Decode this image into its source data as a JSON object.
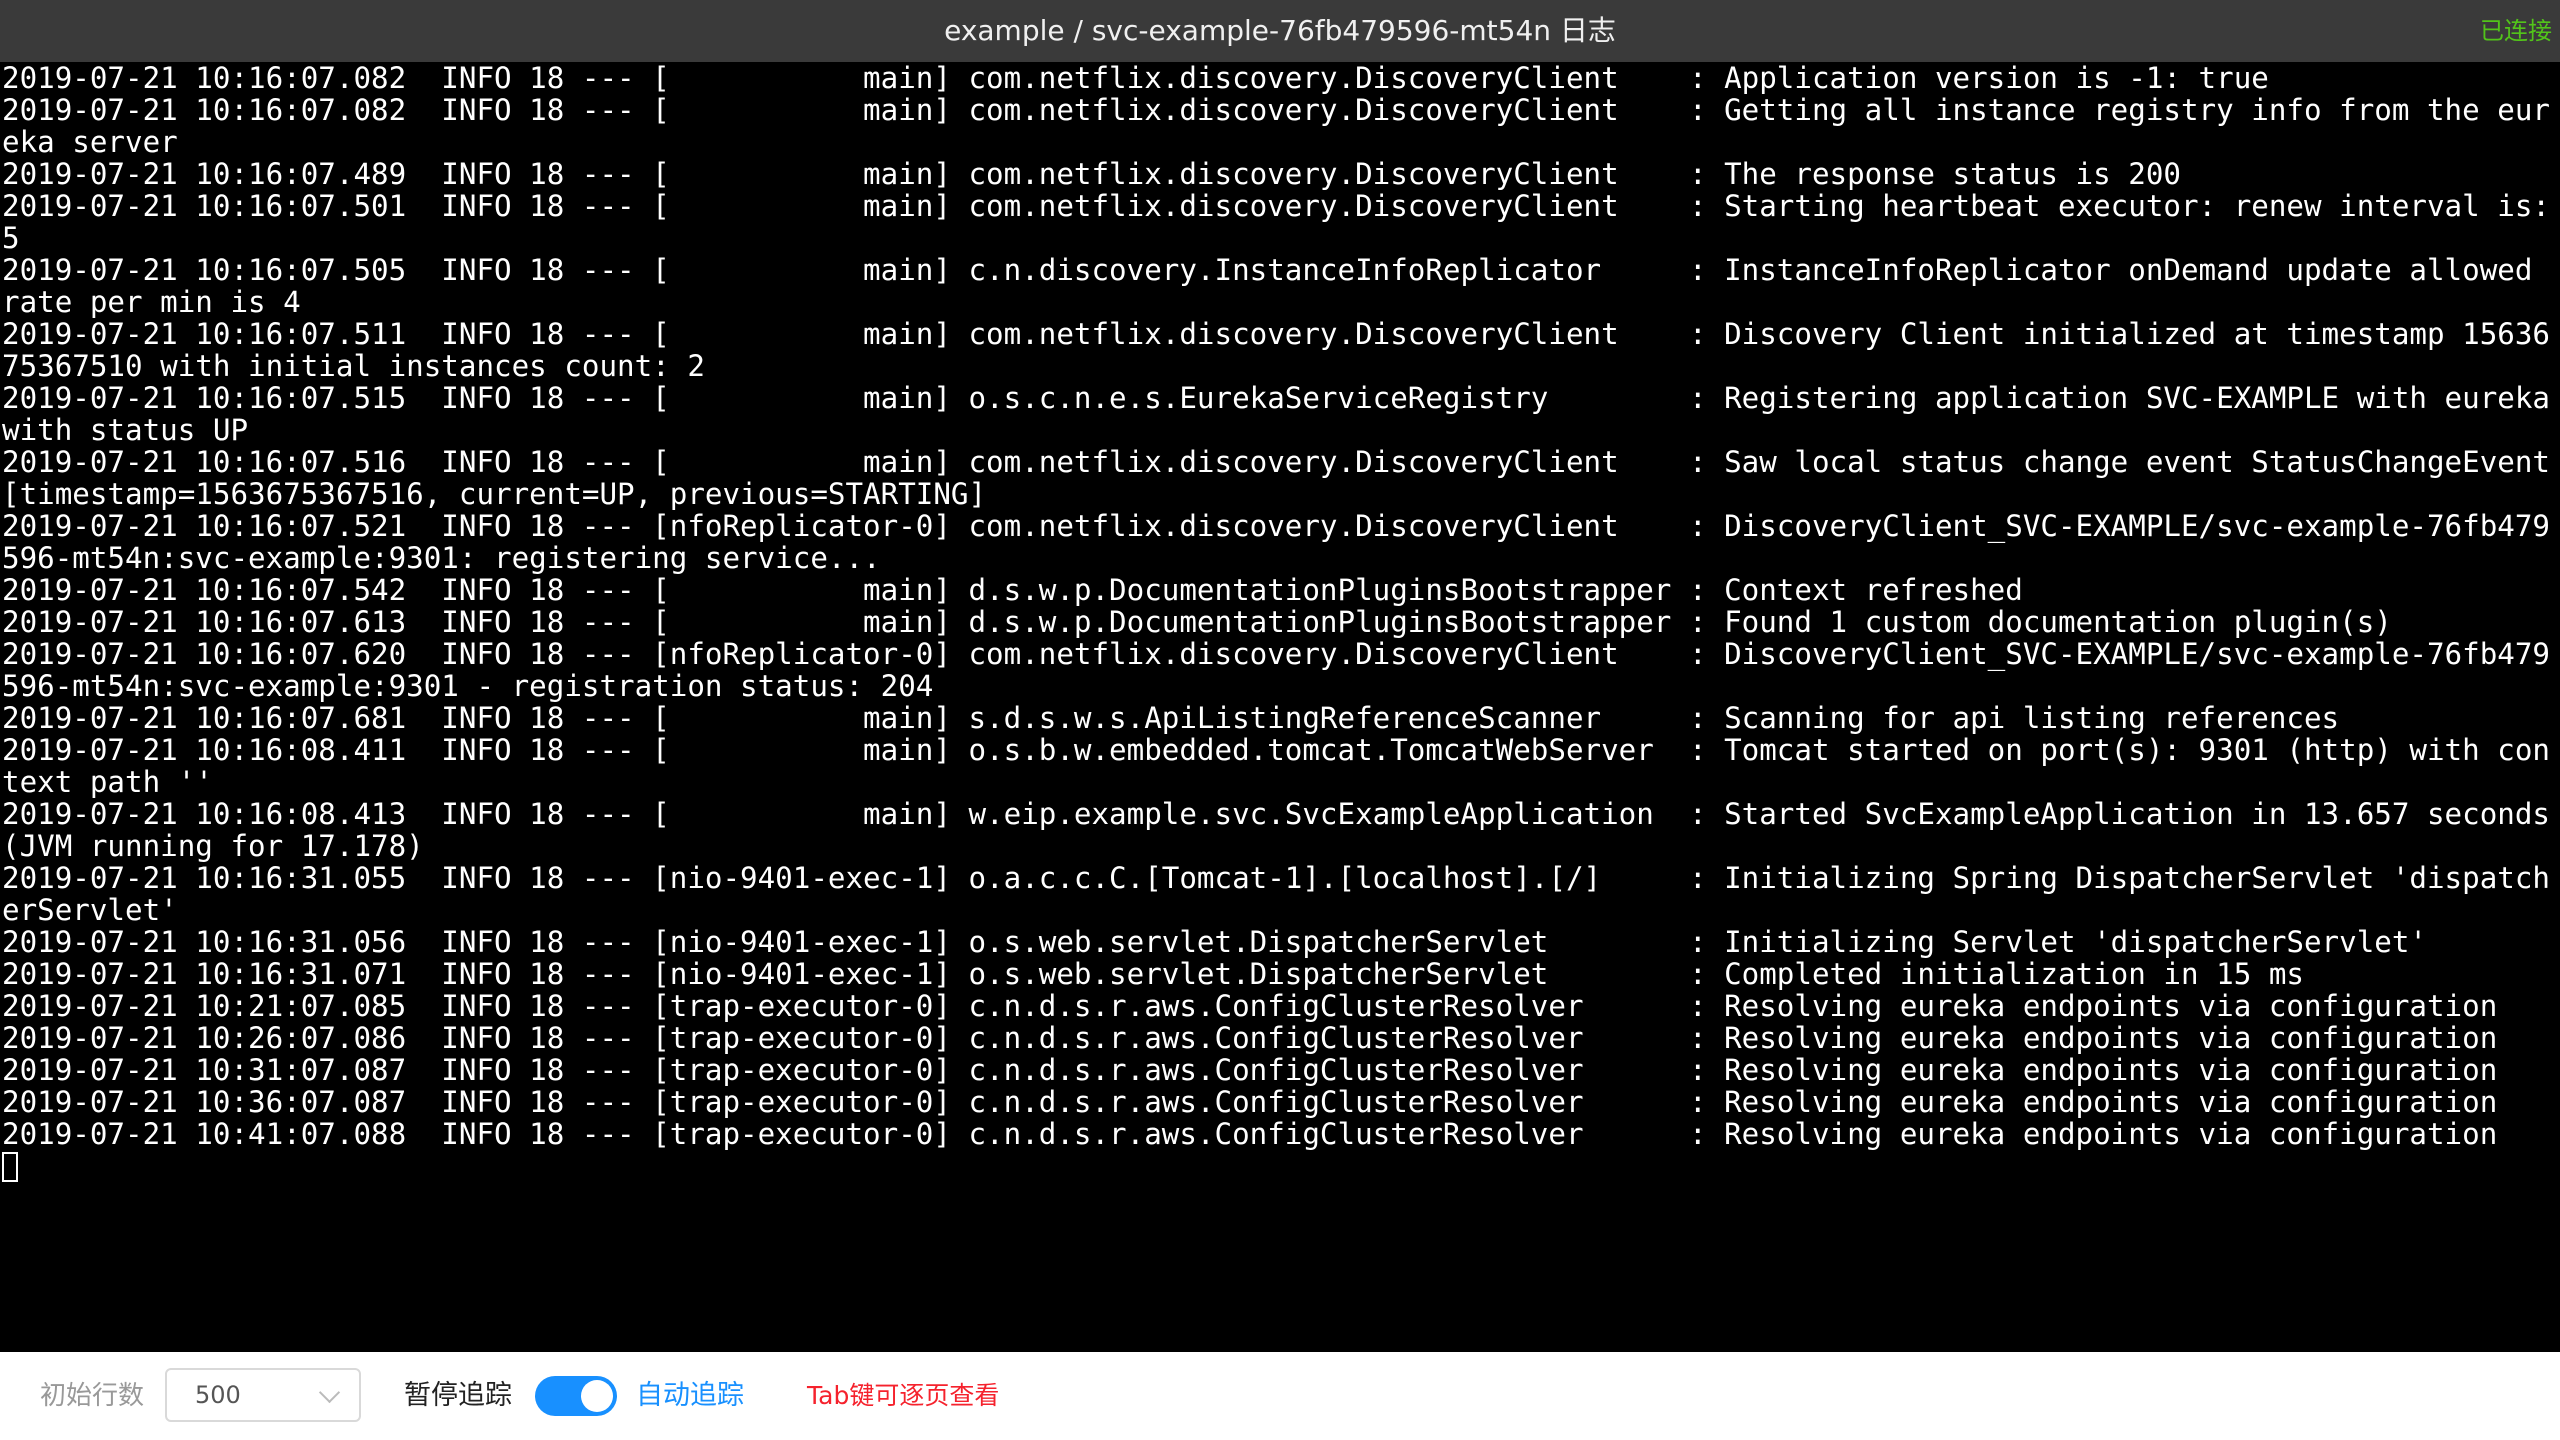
{
  "window": {
    "title": "example / svc-example-76fb479596-mt54n 日志",
    "connection_status": "已连接",
    "connection_color": "#52c41a"
  },
  "log": {
    "lines": [
      "2019-07-21 10:16:07.082  INFO 18 --- [           main] com.netflix.discovery.DiscoveryClient    : Application version is -1: true",
      "2019-07-21 10:16:07.082  INFO 18 --- [           main] com.netflix.discovery.DiscoveryClient    : Getting all instance registry info from the eureka server",
      "2019-07-21 10:16:07.489  INFO 18 --- [           main] com.netflix.discovery.DiscoveryClient    : The response status is 200",
      "2019-07-21 10:16:07.501  INFO 18 --- [           main] com.netflix.discovery.DiscoveryClient    : Starting heartbeat executor: renew interval is: 5",
      "2019-07-21 10:16:07.505  INFO 18 --- [           main] c.n.discovery.InstanceInfoReplicator     : InstanceInfoReplicator onDemand update allowed rate per min is 4",
      "2019-07-21 10:16:07.511  INFO 18 --- [           main] com.netflix.discovery.DiscoveryClient    : Discovery Client initialized at timestamp 1563675367510 with initial instances count: 2",
      "2019-07-21 10:16:07.515  INFO 18 --- [           main] o.s.c.n.e.s.EurekaServiceRegistry        : Registering application SVC-EXAMPLE with eureka with status UP",
      "2019-07-21 10:16:07.516  INFO 18 --- [           main] com.netflix.discovery.DiscoveryClient    : Saw local status change event StatusChangeEvent [timestamp=1563675367516, current=UP, previous=STARTING]",
      "2019-07-21 10:16:07.521  INFO 18 --- [nfoReplicator-0] com.netflix.discovery.DiscoveryClient    : DiscoveryClient_SVC-EXAMPLE/svc-example-76fb479596-mt54n:svc-example:9301: registering service...",
      "2019-07-21 10:16:07.542  INFO 18 --- [           main] d.s.w.p.DocumentationPluginsBootstrapper : Context refreshed",
      "2019-07-21 10:16:07.613  INFO 18 --- [           main] d.s.w.p.DocumentationPluginsBootstrapper : Found 1 custom documentation plugin(s)",
      "2019-07-21 10:16:07.620  INFO 18 --- [nfoReplicator-0] com.netflix.discovery.DiscoveryClient    : DiscoveryClient_SVC-EXAMPLE/svc-example-76fb479596-mt54n:svc-example:9301 - registration status: 204",
      "2019-07-21 10:16:07.681  INFO 18 --- [           main] s.d.s.w.s.ApiListingReferenceScanner     : Scanning for api listing references",
      "2019-07-21 10:16:08.411  INFO 18 --- [           main] o.s.b.w.embedded.tomcat.TomcatWebServer  : Tomcat started on port(s): 9301 (http) with context path ''",
      "2019-07-21 10:16:08.413  INFO 18 --- [           main] w.eip.example.svc.SvcExampleApplication  : Started SvcExampleApplication in 13.657 seconds (JVM running for 17.178)",
      "2019-07-21 10:16:31.055  INFO 18 --- [nio-9401-exec-1] o.a.c.c.C.[Tomcat-1].[localhost].[/]     : Initializing Spring DispatcherServlet 'dispatcherServlet'",
      "2019-07-21 10:16:31.056  INFO 18 --- [nio-9401-exec-1] o.s.web.servlet.DispatcherServlet        : Initializing Servlet 'dispatcherServlet'",
      "2019-07-21 10:16:31.071  INFO 18 --- [nio-9401-exec-1] o.s.web.servlet.DispatcherServlet        : Completed initialization in 15 ms",
      "2019-07-21 10:21:07.085  INFO 18 --- [trap-executor-0] c.n.d.s.r.aws.ConfigClusterResolver      : Resolving eureka endpoints via configuration",
      "2019-07-21 10:26:07.086  INFO 18 --- [trap-executor-0] c.n.d.s.r.aws.ConfigClusterResolver      : Resolving eureka endpoints via configuration",
      "2019-07-21 10:31:07.087  INFO 18 --- [trap-executor-0] c.n.d.s.r.aws.ConfigClusterResolver      : Resolving eureka endpoints via configuration",
      "2019-07-21 10:36:07.087  INFO 18 --- [trap-executor-0] c.n.d.s.r.aws.ConfigClusterResolver      : Resolving eureka endpoints via configuration",
      "2019-07-21 10:41:07.088  INFO 18 --- [trap-executor-0] c.n.d.s.r.aws.ConfigClusterResolver      : Resolving eureka endpoints via configuration"
    ]
  },
  "toolbar": {
    "initial_rows_label": "初始行数",
    "initial_rows_value": "500",
    "pause_label": "暂停追踪",
    "auto_follow_enabled": true,
    "auto_follow_label": "自动追踪",
    "tab_hint": "Tab键可逐页查看",
    "accent_color": "#1890ff",
    "hint_color": "#f5222d"
  }
}
